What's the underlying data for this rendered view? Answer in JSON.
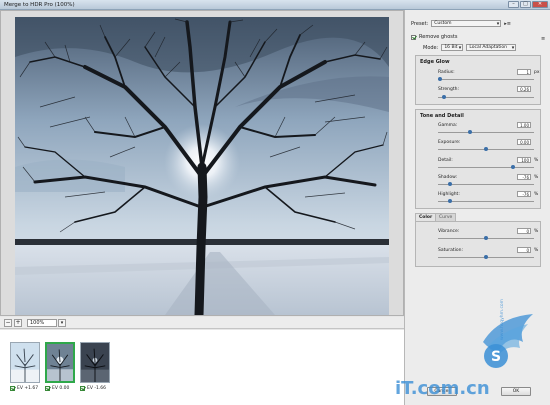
{
  "window": {
    "title": "Merge to HDR Pro (100%)"
  },
  "controls": {
    "minimize": "–",
    "maximize": "□",
    "close": "✕"
  },
  "zoom": {
    "value": "100%"
  },
  "preset": {
    "label": "Preset:",
    "value": "Custom"
  },
  "remove_ghosts": {
    "label": "Remove ghosts"
  },
  "mode": {
    "label": "Mode:",
    "bit_depth": "16 Bit",
    "method": "Local Adaptation"
  },
  "edge_glow": {
    "title": "Edge Glow",
    "radius": {
      "label": "Radius:",
      "value": "1",
      "unit": "px",
      "level": 0.02
    },
    "strength": {
      "label": "Strength:",
      "value": "0.26",
      "level": 0.06
    }
  },
  "tone_detail": {
    "title": "Tone and Detail",
    "gamma": {
      "label": "Gamma:",
      "value": "1.00",
      "level": 0.33
    },
    "exposure": {
      "label": "Exposure:",
      "value": "0.00",
      "level": 0.5
    },
    "detail": {
      "label": "Detail:",
      "value": "100",
      "unit": "%",
      "level": 0.78
    },
    "shadow": {
      "label": "Shadow:",
      "value": "-76",
      "unit": "%",
      "level": 0.12
    },
    "highlight": {
      "label": "Highlight:",
      "value": "-76",
      "unit": "%",
      "level": 0.12
    }
  },
  "tabs": {
    "color": "Color",
    "curve": "Curve"
  },
  "color_tab": {
    "vibrance": {
      "label": "Vibrance:",
      "value": "0",
      "unit": "%",
      "level": 0.5
    },
    "saturation": {
      "label": "Saturation:",
      "value": "0",
      "unit": "%",
      "level": 0.5
    }
  },
  "thumbnails": [
    {
      "label": "EV +1.67"
    },
    {
      "label": "EV 0.00"
    },
    {
      "label": "EV -1.66"
    }
  ],
  "buttons": {
    "cancel": "Cancel",
    "ok": "OK"
  },
  "watermark": {
    "line1": "iT.com.cn",
    "line2": "www.hsqyhm.com"
  },
  "colors": {
    "accent": "#3b6fa8",
    "selected_thumb": "#2fa84a",
    "watermark": "#3b8fd6"
  }
}
